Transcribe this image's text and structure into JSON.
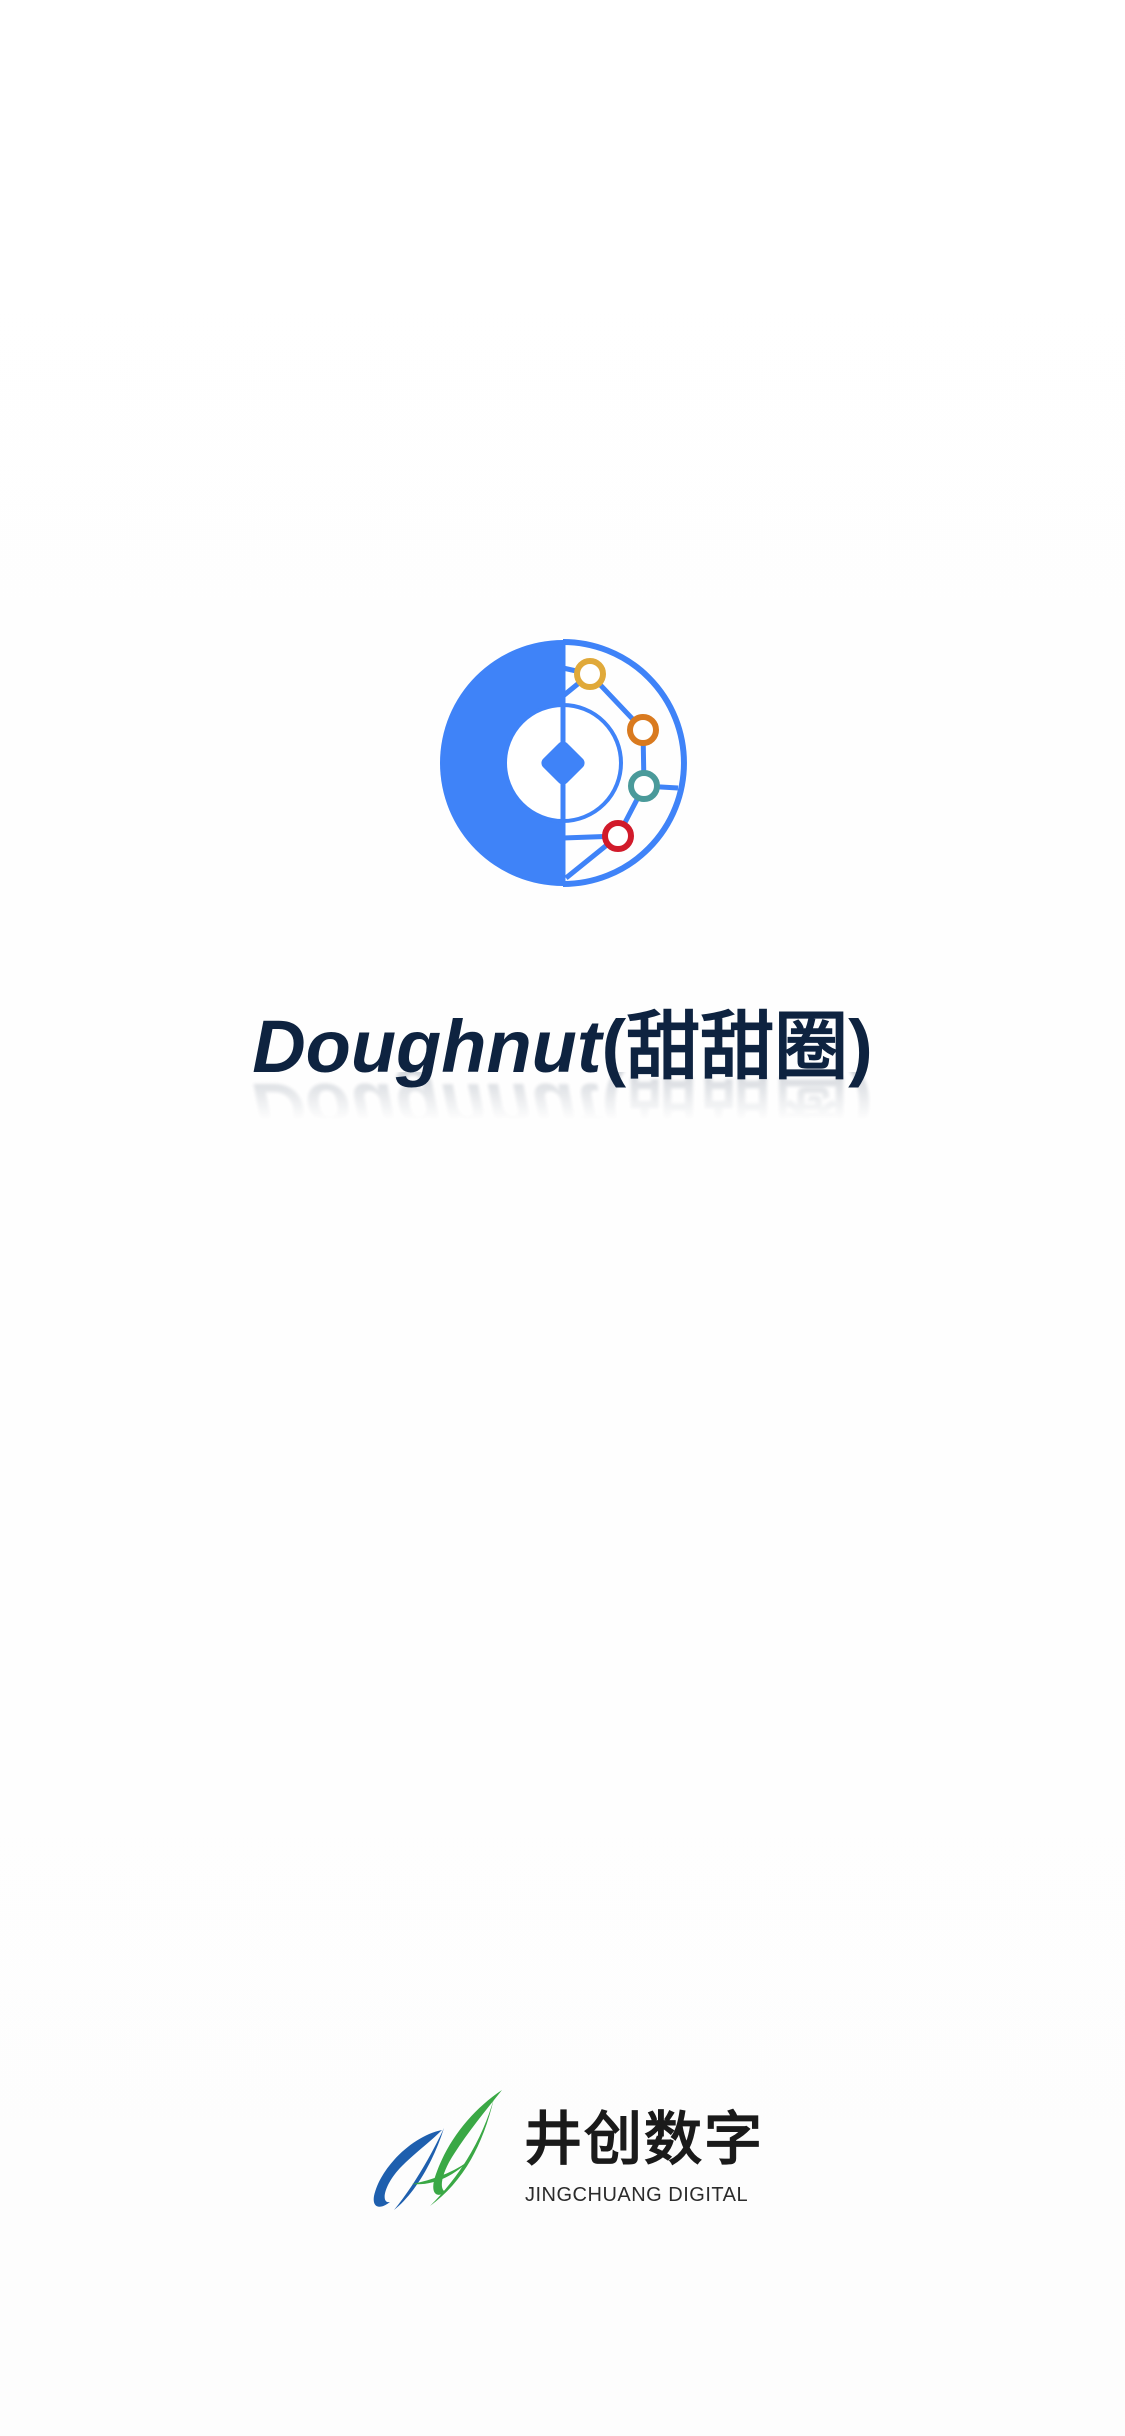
{
  "app": {
    "title_latin": "Doughnut",
    "title_cn": "(甜甜圈)",
    "logo_icon": "doughnut-coin-network-icon",
    "brand_color": "#3f83f8",
    "node_colors": [
      "#e0a93a",
      "#d97a1f",
      "#4a9a9a",
      "#d11a2a"
    ],
    "title_color": "#0e2340"
  },
  "company": {
    "name_cn": "井创数字",
    "name_en": "JINGCHUANG DIGITAL",
    "logo_icon": "jingchuang-leaf-icon",
    "colors": [
      "#1e5fae",
      "#3aa845"
    ]
  }
}
